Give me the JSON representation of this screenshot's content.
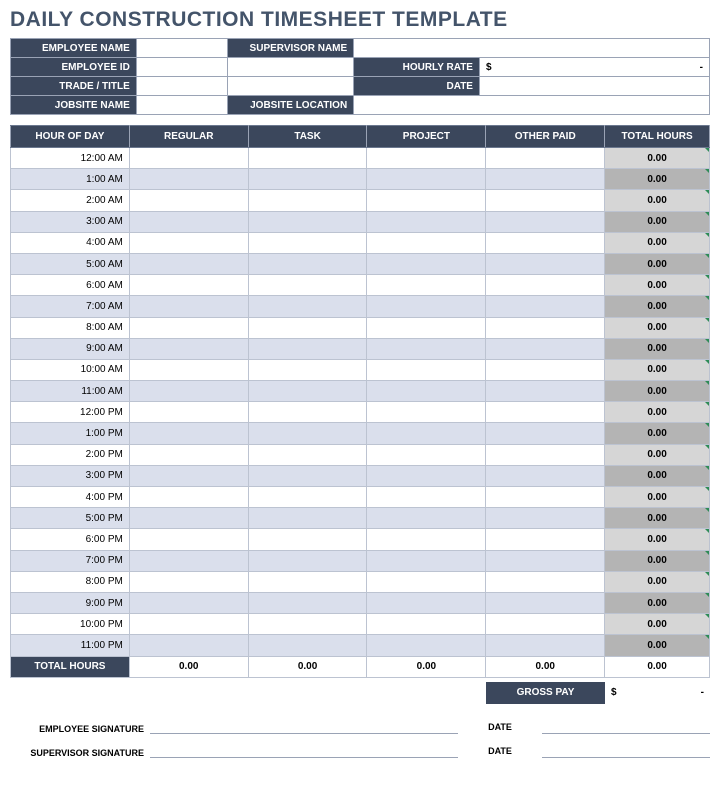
{
  "title": "DAILY CONSTRUCTION TIMESHEET TEMPLATE",
  "header": {
    "employee_name_label": "EMPLOYEE NAME",
    "employee_name": "",
    "supervisor_name_label": "SUPERVISOR NAME",
    "supervisor_name": "",
    "employee_id_label": "EMPLOYEE ID",
    "employee_id": "",
    "hourly_rate_label": "HOURLY RATE",
    "hourly_rate_currency": "$",
    "hourly_rate_dash": "-",
    "trade_title_label": "TRADE / TITLE",
    "trade_title": "",
    "date_label": "DATE",
    "date": "",
    "jobsite_name_label": "JOBSITE NAME",
    "jobsite_name": "",
    "jobsite_location_label": "JOBSITE LOCATION",
    "jobsite_location": ""
  },
  "columns": {
    "hour": "HOUR OF DAY",
    "regular": "REGULAR",
    "task": "TASK",
    "project": "PROJECT",
    "other_paid": "OTHER PAID",
    "total_hours": "TOTAL HOURS"
  },
  "rows": [
    {
      "hour": "12:00 AM",
      "regular": "",
      "task": "",
      "project": "",
      "other": "",
      "total": "0.00"
    },
    {
      "hour": "1:00 AM",
      "regular": "",
      "task": "",
      "project": "",
      "other": "",
      "total": "0.00"
    },
    {
      "hour": "2:00 AM",
      "regular": "",
      "task": "",
      "project": "",
      "other": "",
      "total": "0.00"
    },
    {
      "hour": "3:00 AM",
      "regular": "",
      "task": "",
      "project": "",
      "other": "",
      "total": "0.00"
    },
    {
      "hour": "4:00 AM",
      "regular": "",
      "task": "",
      "project": "",
      "other": "",
      "total": "0.00"
    },
    {
      "hour": "5:00 AM",
      "regular": "",
      "task": "",
      "project": "",
      "other": "",
      "total": "0.00"
    },
    {
      "hour": "6:00 AM",
      "regular": "",
      "task": "",
      "project": "",
      "other": "",
      "total": "0.00"
    },
    {
      "hour": "7:00 AM",
      "regular": "",
      "task": "",
      "project": "",
      "other": "",
      "total": "0.00"
    },
    {
      "hour": "8:00 AM",
      "regular": "",
      "task": "",
      "project": "",
      "other": "",
      "total": "0.00"
    },
    {
      "hour": "9:00 AM",
      "regular": "",
      "task": "",
      "project": "",
      "other": "",
      "total": "0.00"
    },
    {
      "hour": "10:00 AM",
      "regular": "",
      "task": "",
      "project": "",
      "other": "",
      "total": "0.00"
    },
    {
      "hour": "11:00 AM",
      "regular": "",
      "task": "",
      "project": "",
      "other": "",
      "total": "0.00"
    },
    {
      "hour": "12:00 PM",
      "regular": "",
      "task": "",
      "project": "",
      "other": "",
      "total": "0.00"
    },
    {
      "hour": "1:00 PM",
      "regular": "",
      "task": "",
      "project": "",
      "other": "",
      "total": "0.00"
    },
    {
      "hour": "2:00 PM",
      "regular": "",
      "task": "",
      "project": "",
      "other": "",
      "total": "0.00"
    },
    {
      "hour": "3:00 PM",
      "regular": "",
      "task": "",
      "project": "",
      "other": "",
      "total": "0.00"
    },
    {
      "hour": "4:00 PM",
      "regular": "",
      "task": "",
      "project": "",
      "other": "",
      "total": "0.00"
    },
    {
      "hour": "5:00 PM",
      "regular": "",
      "task": "",
      "project": "",
      "other": "",
      "total": "0.00"
    },
    {
      "hour": "6:00 PM",
      "regular": "",
      "task": "",
      "project": "",
      "other": "",
      "total": "0.00"
    },
    {
      "hour": "7:00 PM",
      "regular": "",
      "task": "",
      "project": "",
      "other": "",
      "total": "0.00"
    },
    {
      "hour": "8:00 PM",
      "regular": "",
      "task": "",
      "project": "",
      "other": "",
      "total": "0.00"
    },
    {
      "hour": "9:00 PM",
      "regular": "",
      "task": "",
      "project": "",
      "other": "",
      "total": "0.00"
    },
    {
      "hour": "10:00 PM",
      "regular": "",
      "task": "",
      "project": "",
      "other": "",
      "total": "0.00"
    },
    {
      "hour": "11:00 PM",
      "regular": "",
      "task": "",
      "project": "",
      "other": "",
      "total": "0.00"
    }
  ],
  "totals": {
    "label": "TOTAL HOURS",
    "regular": "0.00",
    "task": "0.00",
    "project": "0.00",
    "other": "0.00",
    "total": "0.00"
  },
  "gross_pay": {
    "label": "GROSS PAY",
    "currency": "$",
    "dash": "-"
  },
  "signatures": {
    "employee_label": "EMPLOYEE SIGNATURE",
    "supervisor_label": "SUPERVISOR SIGNATURE",
    "date_label": "DATE"
  }
}
